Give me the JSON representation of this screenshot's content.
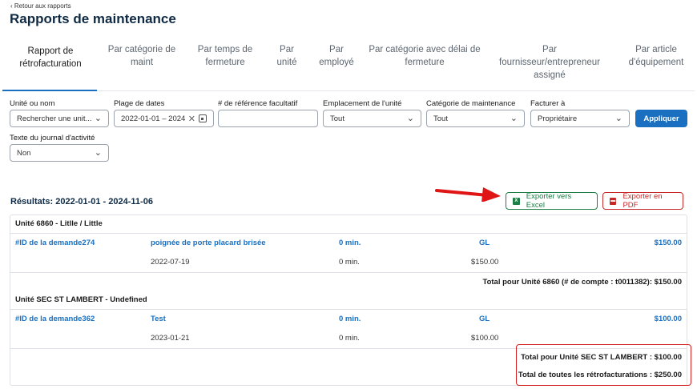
{
  "header": {
    "back_link": "‹ Retour aux rapports",
    "title": "Rapports de maintenance"
  },
  "tabs": [
    {
      "label": "Rapport de rétrofacturation",
      "active": true
    },
    {
      "label": "Par catégorie de maint"
    },
    {
      "label": "Par temps de fermeture"
    },
    {
      "label": "Par unité"
    },
    {
      "label": "Par employé"
    },
    {
      "label": "Par catégorie avec délai de fermeture"
    },
    {
      "label": "Par fournisseur/entrepreneur assigné"
    },
    {
      "label": "Par article d'équipement"
    }
  ],
  "filters": {
    "unit": {
      "label": "Unité ou nom",
      "value": "Rechercher une unit..."
    },
    "date_range": {
      "label": "Plage de dates",
      "value": "2022-01-01 – 2024"
    },
    "reference": {
      "label": "# de référence facultatif",
      "value": ""
    },
    "location": {
      "label": "Emplacement de l'unité",
      "value": "Tout"
    },
    "category": {
      "label": "Catégorie de maintenance",
      "value": "Tout"
    },
    "bill_to": {
      "label": "Facturer à",
      "value": "Propriétaire"
    },
    "journal": {
      "label": "Texte du journal d'activité",
      "value": "Non"
    },
    "apply_label": "Appliquer"
  },
  "results": {
    "title": "Résultats: 2022-01-01 - 2024-11-06",
    "export_excel": "Exporter vers Excel",
    "export_pdf": "Exporter en PDF",
    "groups": [
      {
        "heading": "Unité 6860 - Litlle / Little",
        "request_id": "#ID de la demande274",
        "description": "poignée de porte placard brisée",
        "time": "0 min.",
        "account": "GL",
        "amount": "$150.00",
        "date": "2022-07-19",
        "time2": "0 min.",
        "amount2": "$150.00",
        "total": "Total pour Unité 6860 (# de compte : t0011382): $150.00"
      },
      {
        "heading": "Unité SEC ST LAMBERT - Undefined",
        "request_id": "#ID de la demande362",
        "description": "Test",
        "time": "0 min.",
        "account": "GL",
        "amount": "$100.00",
        "date": "2023-01-21",
        "time2": "0 min.",
        "amount2": "$100.00",
        "total": "Total pour Unité SEC ST LAMBERT : $100.00"
      }
    ],
    "grand_total": "Total de toutes les rétrofacturations : $250.00"
  },
  "colors": {
    "accent": "#1a6fc0",
    "title": "#0f2a44",
    "excel": "#1e7e45",
    "pdf": "#c62828",
    "highlight": "#d62020"
  },
  "icons": {
    "chevron": "chevron-down-icon",
    "calendar": "calendar-icon",
    "clear": "close-icon",
    "excel": "excel-file-icon",
    "pdf": "pdf-file-icon"
  }
}
